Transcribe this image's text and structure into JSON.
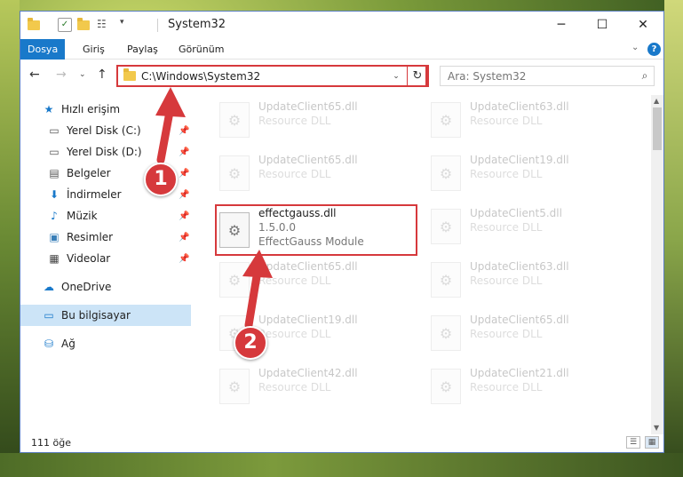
{
  "window": {
    "title": "System32"
  },
  "window_controls": {
    "minimize": "─",
    "maximize": "☐",
    "close": "✕"
  },
  "ribbon": {
    "tabs": [
      "Dosya",
      "Giriş",
      "Paylaş",
      "Görünüm"
    ],
    "active_tab": "Dosya",
    "help": "?"
  },
  "address": {
    "path": "C:\\Windows\\System32",
    "search_placeholder": "Ara: System32"
  },
  "sidebar": {
    "quick_access": "Hızlı erişim",
    "items": [
      {
        "label": "Yerel Disk (C:)",
        "icon": "drive-icon",
        "pinned": true
      },
      {
        "label": "Yerel Disk (D:)",
        "icon": "drive-icon",
        "pinned": true
      },
      {
        "label": "Belgeler",
        "icon": "documents-icon",
        "pinned": true
      },
      {
        "label": "İndirmeler",
        "icon": "download-icon",
        "pinned": true
      },
      {
        "label": "Müzik",
        "icon": "music-icon",
        "pinned": true
      },
      {
        "label": "Resimler",
        "icon": "pictures-icon",
        "pinned": true
      },
      {
        "label": "Videolar",
        "icon": "videos-icon",
        "pinned": true
      }
    ],
    "onedrive": "OneDrive",
    "this_pc": "Bu bilgisayar",
    "network": "Ağ"
  },
  "files": {
    "left": [
      {
        "name": "UpdateClient65.dll",
        "sub": "Resource DLL"
      },
      {
        "name": "UpdateClient65.dll",
        "sub": "Resource DLL"
      },
      {
        "name": "effectgauss.dll",
        "version": "1.5.0.0",
        "sub": "EffectGauss Module"
      },
      {
        "name": "UpdateClient65.dll",
        "sub": "Resource DLL"
      },
      {
        "name": "UpdateClient19.dll",
        "sub": "Resource DLL"
      },
      {
        "name": "UpdateClient42.dll",
        "sub": "Resource DLL"
      }
    ],
    "right": [
      {
        "name": "UpdateClient63.dll",
        "sub": "Resource DLL"
      },
      {
        "name": "UpdateClient19.dll",
        "sub": "Resource DLL"
      },
      {
        "name": "UpdateClient5.dll",
        "sub": "Resource DLL"
      },
      {
        "name": "UpdateClient63.dll",
        "sub": "Resource DLL"
      },
      {
        "name": "UpdateClient65.dll",
        "sub": "Resource DLL"
      },
      {
        "name": "UpdateClient21.dll",
        "sub": "Resource DLL"
      }
    ]
  },
  "status": {
    "count": "111 öğe"
  },
  "callouts": {
    "step1": "1",
    "step2": "2"
  },
  "colors": {
    "accent": "#1979ca",
    "highlight": "#d6393c",
    "selected": "#cce4f7"
  }
}
